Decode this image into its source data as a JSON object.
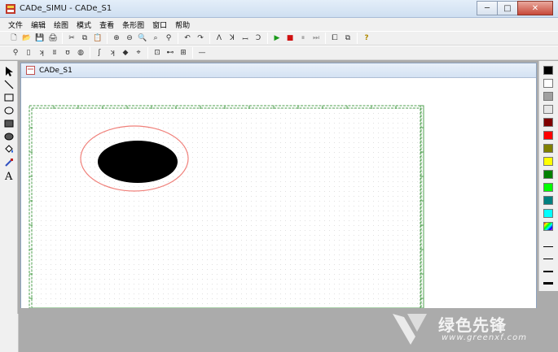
{
  "window": {
    "title": "CADe_SIMU - CADe_S1",
    "minimize": "─",
    "maximize": "□",
    "close": "✕"
  },
  "menu": [
    "文件",
    "编辑",
    "绘图",
    "模式",
    "查看",
    "条形图",
    "窗口",
    "帮助"
  ],
  "toolbar1": [
    {
      "name": "new-icon",
      "glyph": "🗋"
    },
    {
      "name": "open-icon",
      "glyph": "📂"
    },
    {
      "name": "save-icon",
      "glyph": "💾"
    },
    {
      "name": "print-icon",
      "glyph": "🖨"
    },
    {
      "sep": true
    },
    {
      "name": "cut-icon",
      "glyph": "✂"
    },
    {
      "name": "copy-icon",
      "glyph": "⧉"
    },
    {
      "name": "paste-icon",
      "glyph": "📋"
    },
    {
      "sep": true
    },
    {
      "name": "zoom-in-icon",
      "glyph": "⊕"
    },
    {
      "name": "zoom-out-icon",
      "glyph": "⊖"
    },
    {
      "name": "zoom-window-icon",
      "glyph": "🔍"
    },
    {
      "name": "zoom-all-icon",
      "glyph": "⌕"
    },
    {
      "name": "zoom-page-icon",
      "glyph": "⚲"
    },
    {
      "sep": true
    },
    {
      "name": "undo-icon",
      "glyph": "↶"
    },
    {
      "name": "redo-icon",
      "glyph": "↷"
    },
    {
      "sep": true
    },
    {
      "name": "tool-a-icon",
      "glyph": "ꓥ"
    },
    {
      "name": "tool-b-icon",
      "glyph": "ꓘ"
    },
    {
      "name": "tool-c-icon",
      "glyph": "ꟷ"
    },
    {
      "name": "tool-d-icon",
      "glyph": "ꓛ"
    },
    {
      "sep": true
    },
    {
      "name": "run-icon",
      "glyph": "▶"
    },
    {
      "name": "stop-icon",
      "glyph": "■"
    },
    {
      "name": "pause-icon",
      "glyph": "⏸"
    },
    {
      "name": "step-icon",
      "glyph": "⏭"
    },
    {
      "sep": true
    },
    {
      "name": "window-icon",
      "glyph": "⧠"
    },
    {
      "name": "windows-icon",
      "glyph": "⧉"
    },
    {
      "sep": true
    },
    {
      "name": "help-icon",
      "glyph": "?"
    }
  ],
  "toolbar2": [
    {
      "name": "comp-1-icon",
      "glyph": "⚲"
    },
    {
      "name": "comp-2-icon",
      "glyph": "▯"
    },
    {
      "name": "comp-3-icon",
      "glyph": "ʞ"
    },
    {
      "name": "comp-4-icon",
      "glyph": "ʬ"
    },
    {
      "name": "comp-5-icon",
      "glyph": "ʊ"
    },
    {
      "name": "comp-6-icon",
      "glyph": "◍"
    },
    {
      "sep": true
    },
    {
      "name": "comp-7-icon",
      "glyph": "ʃ"
    },
    {
      "name": "comp-8-icon",
      "glyph": "ʞ"
    },
    {
      "name": "comp-9-icon",
      "glyph": "◆"
    },
    {
      "name": "comp-10-icon",
      "glyph": "⌖"
    },
    {
      "sep": true
    },
    {
      "name": "comp-11-icon",
      "glyph": "⊡"
    },
    {
      "name": "comp-12-icon",
      "glyph": "⊷"
    },
    {
      "name": "comp-13-icon",
      "glyph": "⊞"
    },
    {
      "sep": true
    },
    {
      "name": "line-icon",
      "glyph": "—"
    }
  ],
  "document": {
    "title": "CADe_S1"
  },
  "drawing": {
    "grid_color": "#4fa04f",
    "ring_color": "#f0807a",
    "fill_color": "#000000"
  },
  "colors": [
    "#000000",
    "#ffffff",
    "#a0a0a0",
    "#e6e6e6",
    "#800000",
    "#ff0000",
    "#808000",
    "#ffff00",
    "#008000",
    "#00ff00",
    "#008080",
    "#00ffff"
  ],
  "watermark": {
    "text": "绿色先锋",
    "url": "www.greenxf.com"
  }
}
